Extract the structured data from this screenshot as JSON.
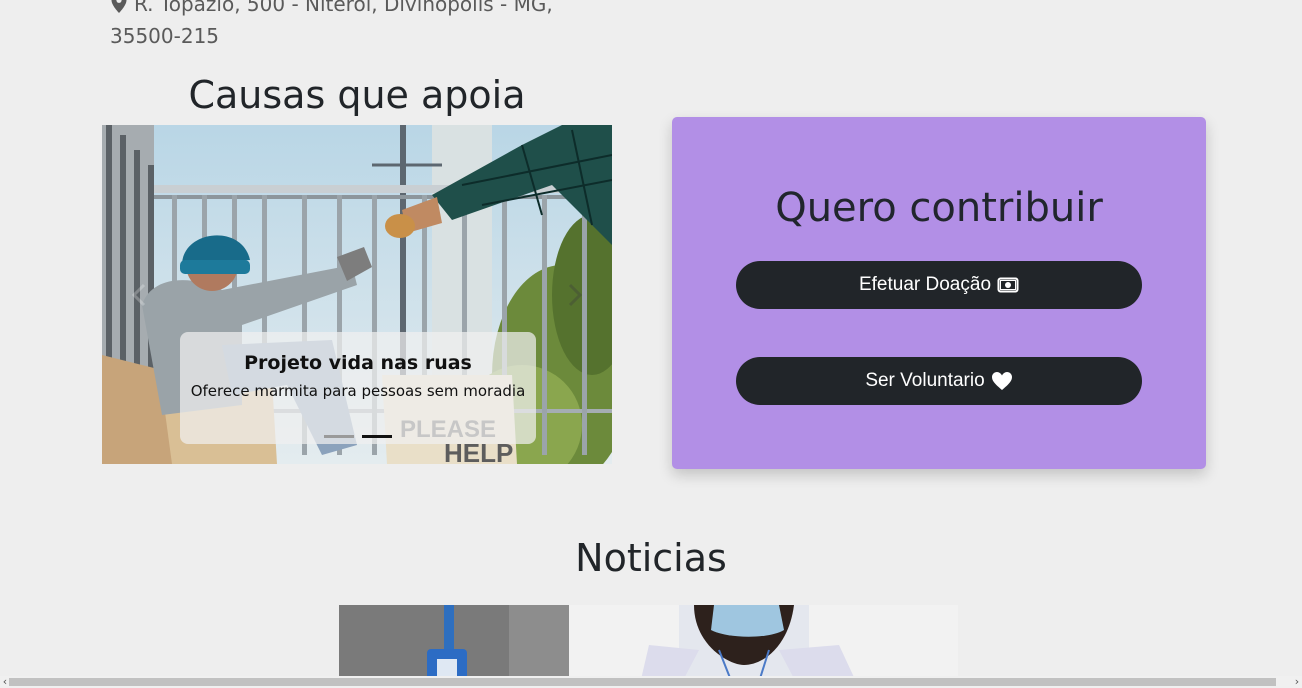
{
  "address": {
    "line1": "R. Topázio, 500 - Niterói, Divinópolis - MG,",
    "line2": "35500-215"
  },
  "causes": {
    "title": "Causas que apoia",
    "slide": {
      "title": "Projeto vida nas ruas",
      "description": "Oferece marmita para pessoas sem moradia"
    },
    "indicator_count": 2,
    "active_indicator": 2,
    "sign_text": "PLEASE HELP"
  },
  "contribute": {
    "title": "Quero contribuir",
    "donate_label": "Efetuar Doação",
    "volunteer_label": "Ser Voluntario"
  },
  "news": {
    "title": "Noticias"
  },
  "colors": {
    "background": "#eeeeee",
    "card": "#b28fe6",
    "button": "#212529",
    "button_text": "#ffffff"
  },
  "icons": {
    "address": "map-pin-icon",
    "donate": "cash-icon",
    "volunteer": "heart-icon",
    "prev": "chevron-left-icon",
    "next": "chevron-right-icon"
  }
}
